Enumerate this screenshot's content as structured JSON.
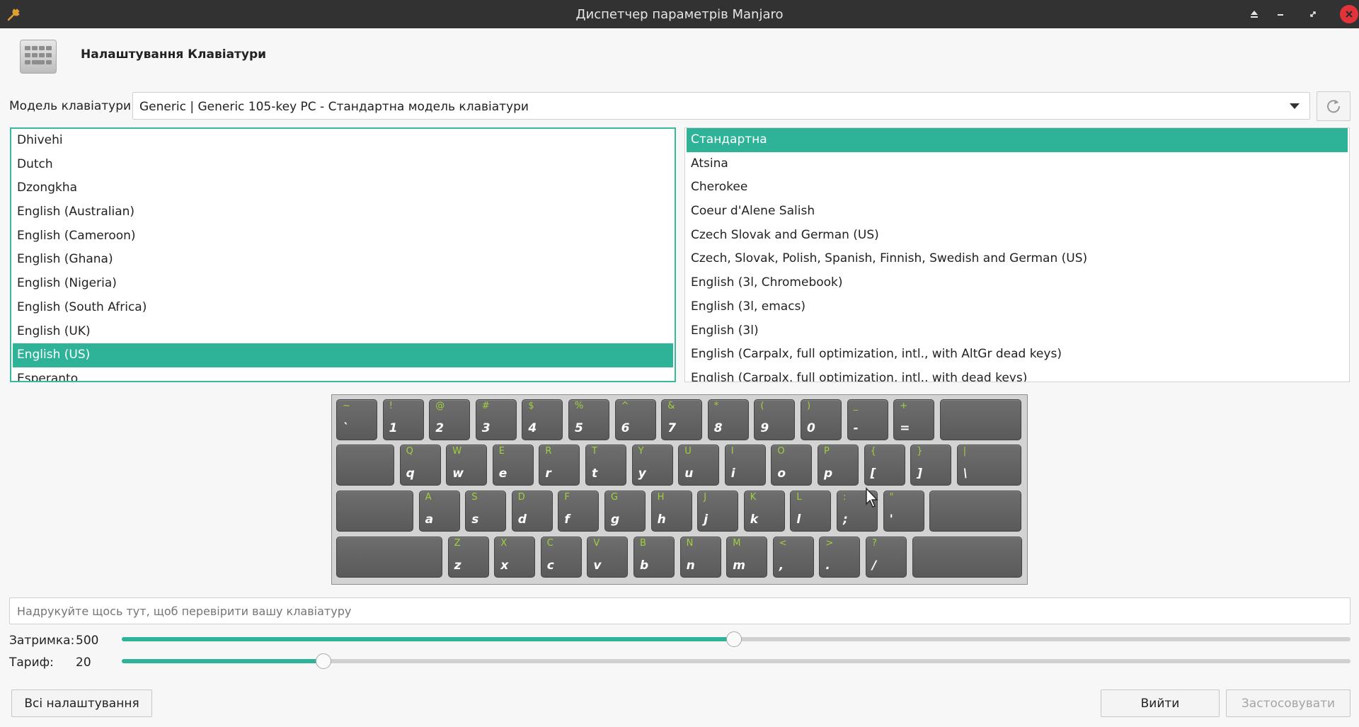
{
  "window": {
    "title": "Диспетчер параметрів Manjaro"
  },
  "header": {
    "title": "Налаштування Клавіатури"
  },
  "model": {
    "label": "Модель клавіатури:",
    "value": "Generic | Generic 105-key PC - Стандартна модель клавіатури"
  },
  "layouts": {
    "items": [
      "Dhivehi",
      "Dutch",
      "Dzongkha",
      "English (Australian)",
      "English (Cameroon)",
      "English (Ghana)",
      "English (Nigeria)",
      "English (South Africa)",
      "English (UK)",
      "English (US)",
      "Esperanto"
    ],
    "selected": "English (US)"
  },
  "variants": {
    "items": [
      "Стандартна",
      "Atsina",
      "Cherokee",
      "Coeur d'Alene Salish",
      "Czech Slovak and German (US)",
      "Czech, Slovak, Polish, Spanish, Finnish, Swedish and German (US)",
      "English (3l, Chromebook)",
      "English (3l, emacs)",
      "English (3l)",
      "English (Carpalx, full optimization, intl., with AltGr dead keys)",
      "English (Carpalx, full optimization, intl., with dead keys)"
    ],
    "selected": "Стандартна"
  },
  "keyboard_rows": [
    [
      [
        "~",
        "`"
      ],
      [
        "!",
        "1"
      ],
      [
        "@",
        "2"
      ],
      [
        "#",
        "3"
      ],
      [
        "$",
        "4"
      ],
      [
        "%",
        "5"
      ],
      [
        "^",
        "6"
      ],
      [
        "&",
        "7"
      ],
      [
        "*",
        "8"
      ],
      [
        "(",
        "9"
      ],
      [
        ")",
        "0"
      ],
      [
        "_",
        "-"
      ],
      [
        "+",
        "="
      ],
      [
        "",
        ""
      ]
    ],
    [
      [
        "",
        ""
      ],
      [
        "Q",
        "q"
      ],
      [
        "W",
        "w"
      ],
      [
        "E",
        "e"
      ],
      [
        "R",
        "r"
      ],
      [
        "T",
        "t"
      ],
      [
        "Y",
        "y"
      ],
      [
        "U",
        "u"
      ],
      [
        "I",
        "i"
      ],
      [
        "O",
        "o"
      ],
      [
        "P",
        "p"
      ],
      [
        "{",
        "["
      ],
      [
        "}",
        "]"
      ],
      [
        "|",
        "\\"
      ]
    ],
    [
      [
        "",
        ""
      ],
      [
        "A",
        "a"
      ],
      [
        "S",
        "s"
      ],
      [
        "D",
        "d"
      ],
      [
        "F",
        "f"
      ],
      [
        "G",
        "g"
      ],
      [
        "H",
        "h"
      ],
      [
        "J",
        "j"
      ],
      [
        "K",
        "k"
      ],
      [
        "L",
        "l"
      ],
      [
        ":",
        ";"
      ],
      [
        "\"",
        "'"
      ],
      [
        "",
        ""
      ]
    ],
    [
      [
        "",
        ""
      ],
      [
        "Z",
        "z"
      ],
      [
        "X",
        "x"
      ],
      [
        "C",
        "c"
      ],
      [
        "V",
        "v"
      ],
      [
        "B",
        "b"
      ],
      [
        "N",
        "n"
      ],
      [
        "M",
        "m"
      ],
      [
        "<",
        ","
      ],
      [
        ">",
        "."
      ],
      [
        "?",
        "/"
      ],
      [
        "",
        ""
      ]
    ]
  ],
  "test_input": {
    "placeholder": "Надрукуйте щось тут, щоб перевірити вашу клавіатуру"
  },
  "delay": {
    "label": "Затримка:",
    "value": "500",
    "fraction": 0.498
  },
  "rate": {
    "label": "Тариф:",
    "value": "20",
    "fraction": 0.164
  },
  "buttons": {
    "all_settings": "Всі налаштування",
    "quit": "Вийти",
    "apply": "Застосовувати"
  },
  "colors": {
    "accent": "#2eb398",
    "titlebar": "#323232",
    "close": "#e2333a",
    "key_shift_label": "#9fd13b"
  }
}
